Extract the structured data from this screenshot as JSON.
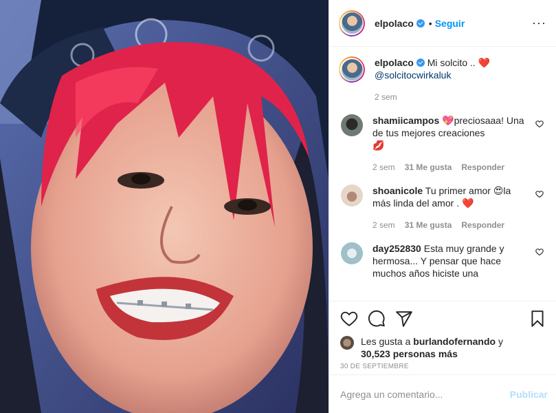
{
  "header": {
    "username": "elpolaco",
    "separator": "•",
    "follow_label": "Seguir",
    "more_label": "···"
  },
  "caption": {
    "username": "elpolaco",
    "text": "Mi solcito .. ",
    "emoji": "❤️",
    "mention": "@solcitocwirkaluk",
    "time": "2 sem"
  },
  "comments": [
    {
      "username": "shamiicampos",
      "text_prefix": "💖",
      "text": "preciosaaa! Una de tus mejores creaciones",
      "text_suffix": "💋",
      "time": "2 sem",
      "likes": "31 Me gusta",
      "reply": "Responder",
      "avatar_color": "#3d4a4a"
    },
    {
      "username": "shoanicole",
      "text_prefix": "",
      "text": "Tu primer amor 😍la más linda del amor . ",
      "text_suffix": "❤️",
      "time": "2 sem",
      "likes": "31 Me gusta",
      "reply": "Responder",
      "avatar_color": "#d9c2b0"
    },
    {
      "username": "day252830",
      "text_prefix": "",
      "text": "Esta muy grande y hermosa... Y pensar que hace muchos años hiciste una",
      "text_suffix": "",
      "time": "",
      "likes": "",
      "reply": "",
      "avatar_color": "#b9cfd4"
    }
  ],
  "actions": {
    "like_icon": "heart-outline-icon",
    "comment_icon": "comment-icon",
    "share_icon": "paper-plane-icon",
    "save_icon": "bookmark-icon"
  },
  "likes": {
    "prefix": "Les gusta a ",
    "user": "burlandofernando",
    "connector": " y",
    "count": "30,523 personas más"
  },
  "date": "30 DE SEPTIEMBRE",
  "add_comment": {
    "placeholder": "Agrega un comentario...",
    "publish_label": "Publicar"
  },
  "colors": {
    "accent": "#0095f6",
    "publish_disabled": "#b2dffc",
    "heart": "#ed4956",
    "muted": "#8e8e8e"
  }
}
